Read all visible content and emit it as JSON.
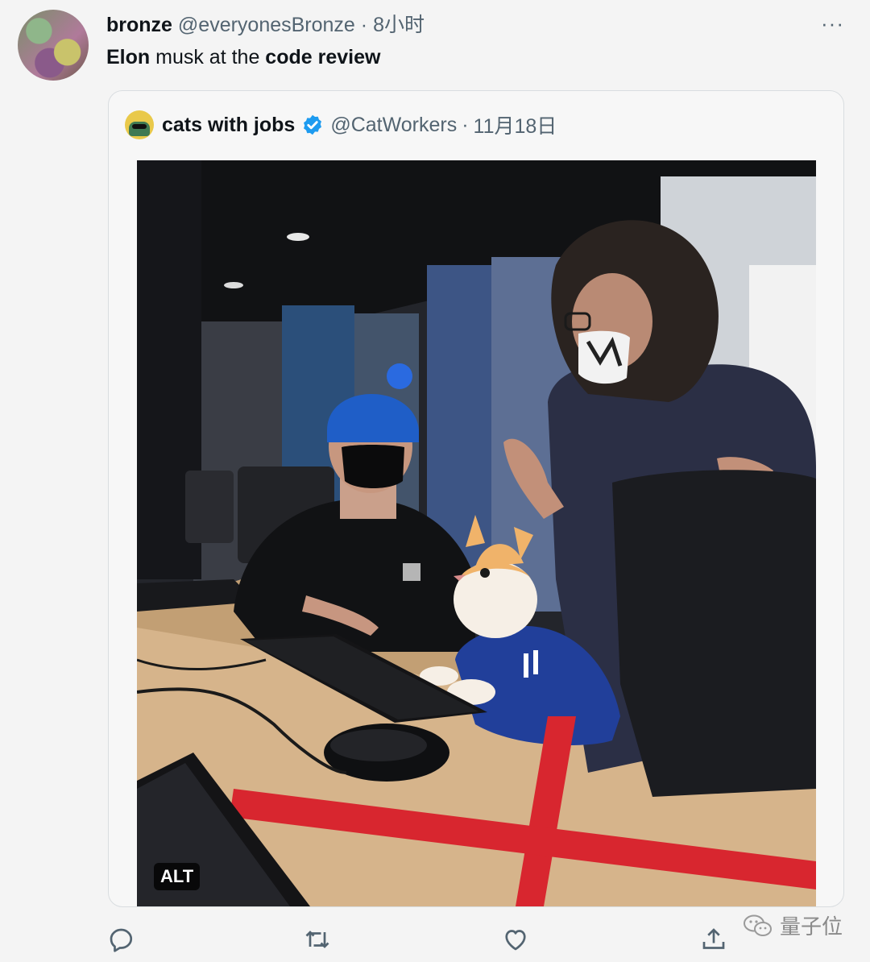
{
  "tweet": {
    "author_name": "bronze",
    "author_handle": "@everyonesBronze",
    "separator": "·",
    "time": "8小时",
    "more": "···",
    "text_parts": [
      "Elon",
      " musk at the ",
      "code review"
    ]
  },
  "quoted": {
    "name": "cats with jobs",
    "handle": "@CatWorkers",
    "separator": "·",
    "date": "11月18日",
    "alt_badge": "ALT"
  },
  "actions": {
    "icons": [
      "reply-icon",
      "retweet-icon",
      "like-icon",
      "share-icon"
    ]
  },
  "watermark": {
    "text": "量子位"
  },
  "colors": {
    "verified": "#1d9bf0",
    "muted_text": "#536471"
  }
}
